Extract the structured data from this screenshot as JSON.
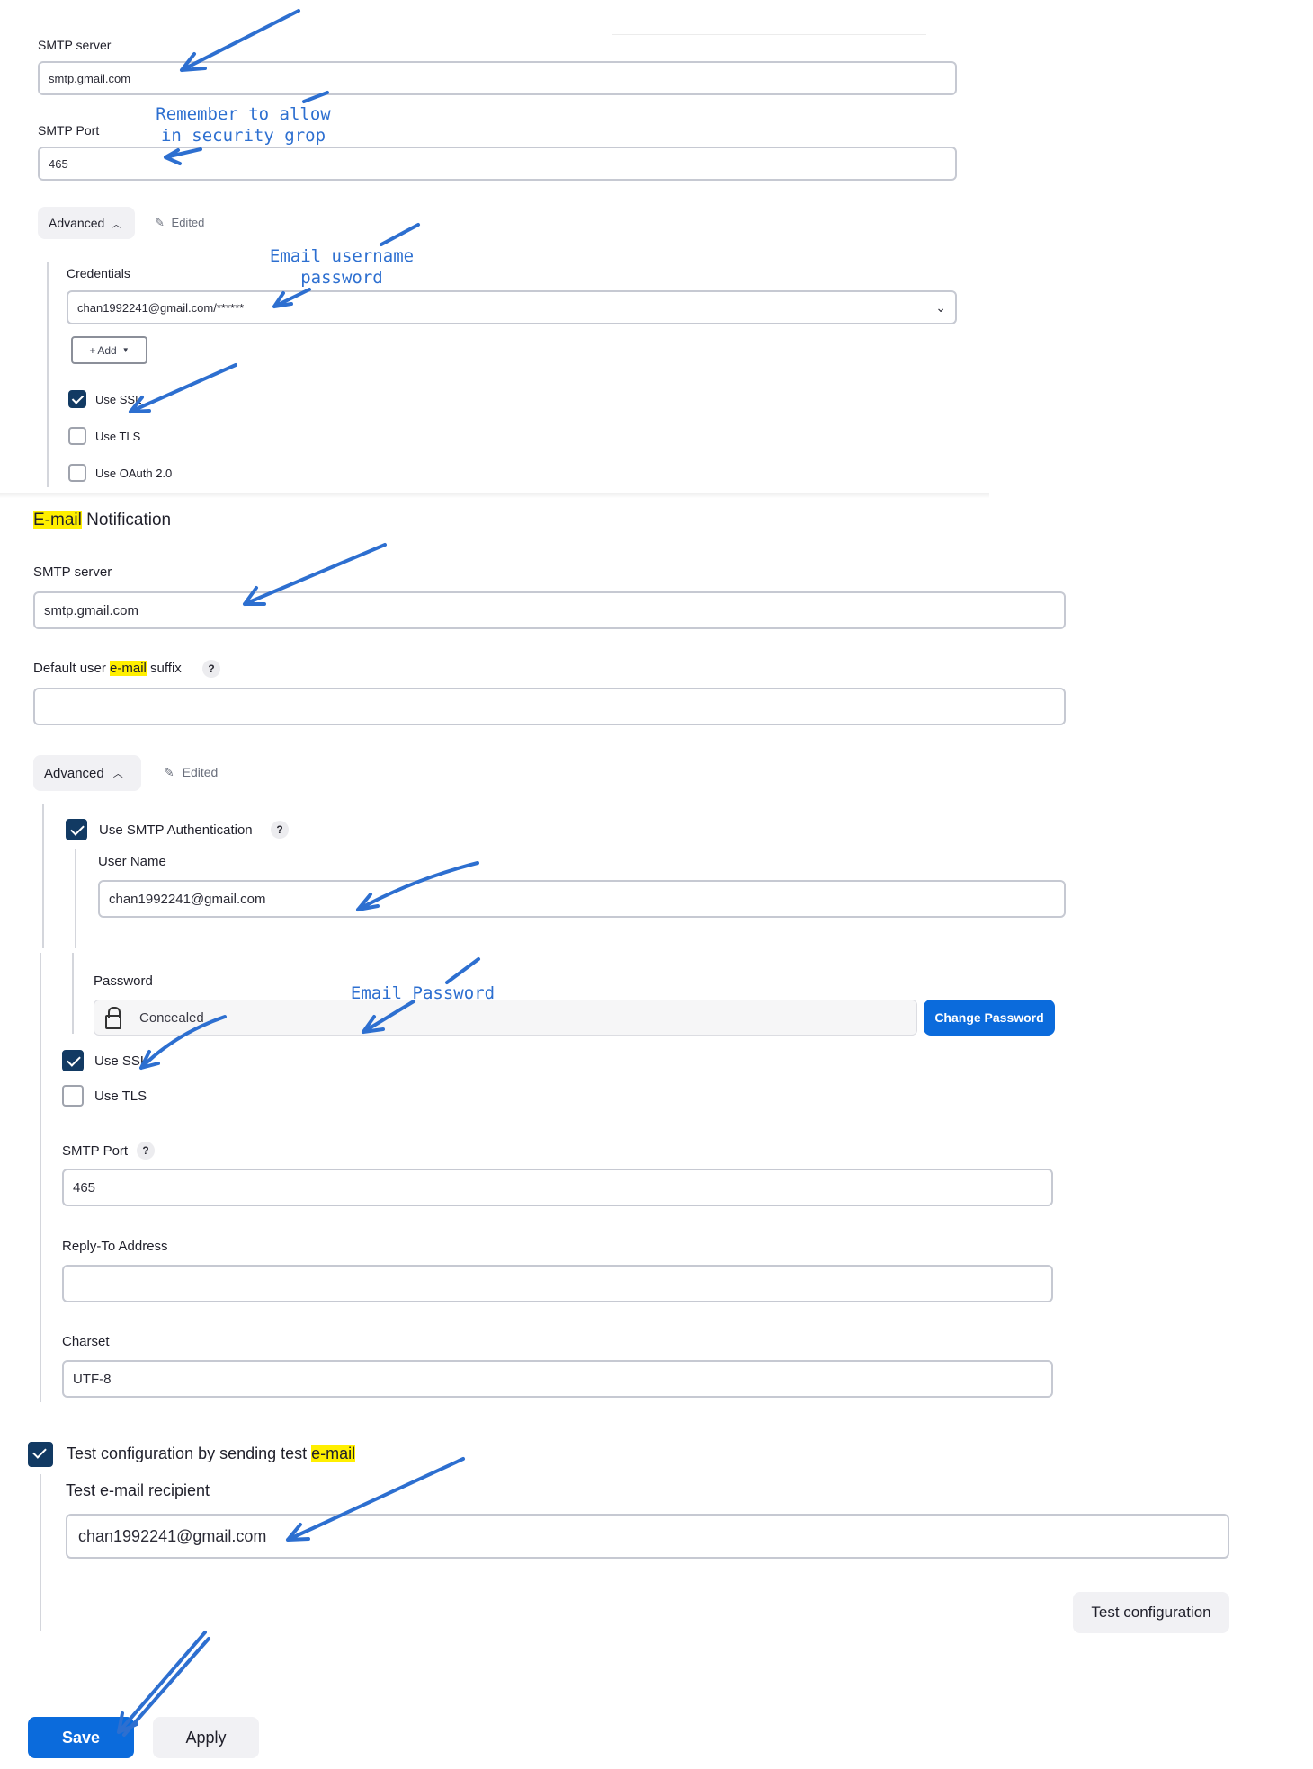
{
  "top": {
    "smtp_server_label": "SMTP server",
    "smtp_server_value": "smtp.gmail.com",
    "smtp_port_label": "SMTP Port",
    "smtp_port_value": "465",
    "advanced_label": "Advanced",
    "edited_label": "Edited",
    "credentials_label": "Credentials",
    "credentials_value": "chan1992241@gmail.com/******",
    "add_label": "Add",
    "use_ssl_label": "Use SSL",
    "use_ssl_checked": true,
    "use_tls_label": "Use TLS",
    "use_tls_checked": false,
    "use_oauth_label": "Use OAuth 2.0",
    "use_oauth_checked": false
  },
  "email": {
    "section_title_hl": "E-mail",
    "section_title_rest": " Notification",
    "smtp_server_label": "SMTP server",
    "smtp_server_value": "smtp.gmail.com",
    "suffix_label_pre": "Default user ",
    "suffix_label_hl": "e-mail",
    "suffix_label_post": " suffix",
    "suffix_value": "",
    "advanced_label": "Advanced",
    "edited_label": "Edited",
    "use_smtp_auth_label": "Use SMTP Authentication",
    "use_smtp_auth_checked": true,
    "user_name_label": "User Name",
    "user_name_value": "chan1992241@gmail.com",
    "password_label": "Password",
    "password_value": "Concealed",
    "change_password_label": "Change Password",
    "use_ssl_label": "Use SSL",
    "use_ssl_checked": true,
    "use_tls_label": "Use TLS",
    "use_tls_checked": false,
    "smtp_port_label": "SMTP Port",
    "smtp_port_value": "465",
    "reply_to_label": "Reply-To Address",
    "reply_to_value": "",
    "charset_label": "Charset",
    "charset_value": "UTF-8",
    "test_config_label_pre": "Test configuration by sending test ",
    "test_config_label_hl": "e-mail",
    "test_config_checked": true,
    "test_recipient_label": "Test e-mail recipient",
    "test_recipient_value": "chan1992241@gmail.com",
    "test_button_label": "Test configuration"
  },
  "footer": {
    "save_label": "Save",
    "apply_label": "Apply"
  },
  "annotations": {
    "security_group_note": "Remember to allow\nin security grop",
    "credentials_note": "Email username\npassword",
    "password_note": "Email Password",
    "arrow_color": "#2d6fd0"
  },
  "colors": {
    "accent": "#0b6bdc",
    "checkbox_checked": "#123a63",
    "highlight": "#ffef00"
  }
}
